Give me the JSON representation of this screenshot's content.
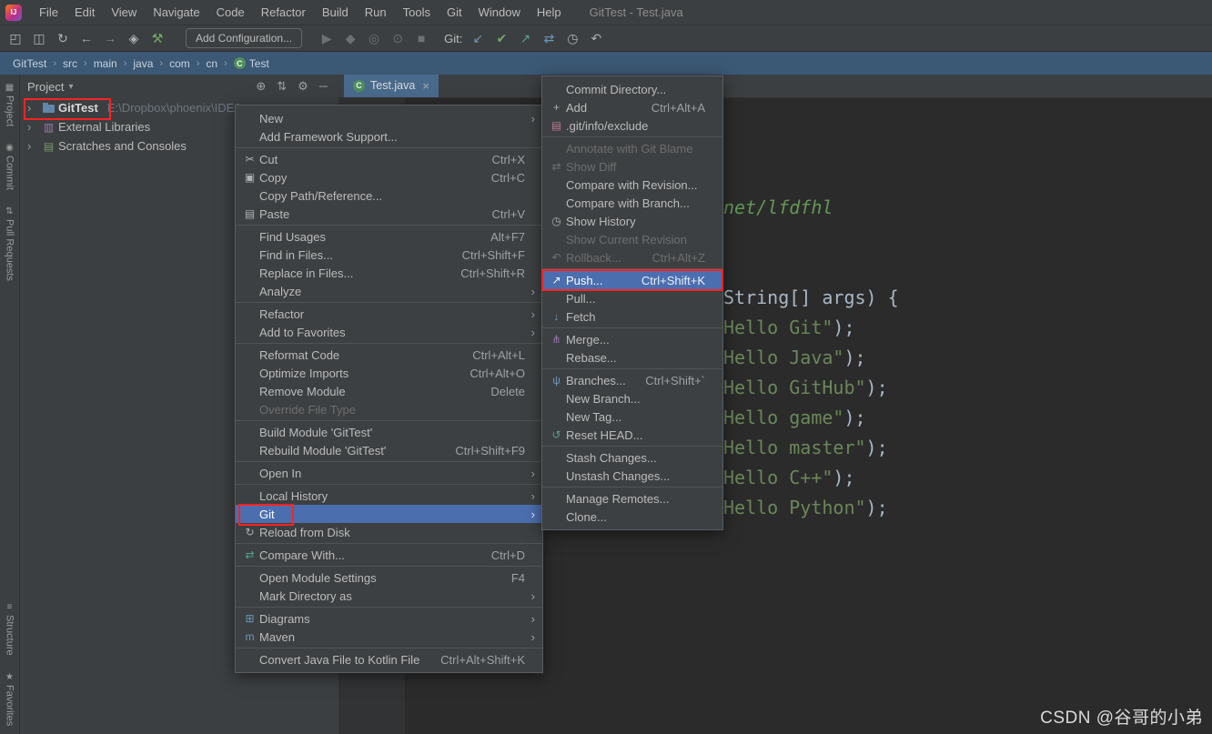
{
  "window": {
    "title": "GitTest - Test.java",
    "logo_text": "IJ",
    "menu_items": [
      "File",
      "Edit",
      "View",
      "Navigate",
      "Code",
      "Refactor",
      "Build",
      "Run",
      "Tools",
      "Git",
      "Window",
      "Help"
    ]
  },
  "toolbar": {
    "left_icons": [
      "open-icon",
      "save-icon",
      "sync-icon",
      "back-icon",
      "forward-icon",
      "modules-icon",
      "build-icon"
    ],
    "add_configuration_label": "Add Configuration...",
    "run_icons": [
      "run-icon",
      "debug-icon",
      "coverage-icon",
      "profiler-icon",
      "stop-icon"
    ],
    "git_label": "Git:",
    "git_icons": [
      "update-project-icon",
      "commit-check-icon",
      "push-arrow-icon",
      "diff-icon",
      "history-icon",
      "rollback-icon"
    ]
  },
  "breadcrumb": {
    "items": [
      {
        "label": "GitTest"
      },
      {
        "label": "src"
      },
      {
        "label": "main"
      },
      {
        "label": "java"
      },
      {
        "label": "com"
      },
      {
        "label": "cn"
      },
      {
        "label": "Test",
        "icon": "class-icon"
      }
    ]
  },
  "left_strip": {
    "top": [
      {
        "label": "Project",
        "icon": "project-tool-icon"
      },
      {
        "label": "Commit",
        "icon": "commit-tool-icon"
      },
      {
        "label": "Pull Requests",
        "icon": "pull-requests-icon"
      }
    ],
    "bottom": [
      {
        "label": "Structure",
        "icon": "structure-tool-icon"
      },
      {
        "label": "Favorites",
        "icon": "favorites-tool-icon"
      }
    ]
  },
  "project_panel": {
    "header": "Project",
    "header_icons": [
      "locate-icon",
      "collapse-all-icon",
      "gear-icon",
      "hide-icon"
    ],
    "tree": [
      {
        "label": "GitTest",
        "path": "E:\\Dropbox\\phoenix\\IDEA",
        "icon": "module-folder-icon",
        "bold": true,
        "red_box": true
      },
      {
        "label": "External Libraries",
        "icon": "libraries-icon"
      },
      {
        "label": "Scratches and Consoles",
        "icon": "scratches-icon"
      }
    ]
  },
  "editor": {
    "tab": {
      "label": "Test.java",
      "icon": "class-icon",
      "close": "×"
    },
    "code_lines": [
      {
        "row": 0,
        "segments": [
          {
            "text": "net/lfdfhl",
            "style": "comment"
          }
        ]
      },
      {
        "row": 3,
        "segments": [
          {
            "text": "String[] args) {",
            "style": "plain"
          }
        ]
      },
      {
        "row": 4,
        "segments": [
          {
            "text": "Hello Git\"",
            "style": "string"
          },
          {
            "text": ");",
            "style": "plain"
          }
        ]
      },
      {
        "row": 5,
        "segments": [
          {
            "text": "Hello Java\"",
            "style": "string"
          },
          {
            "text": ");",
            "style": "plain"
          }
        ]
      },
      {
        "row": 6,
        "segments": [
          {
            "text": "Hello GitHub\"",
            "style": "string"
          },
          {
            "text": ");",
            "style": "plain"
          }
        ]
      },
      {
        "row": 7,
        "segments": [
          {
            "text": "Hello game\"",
            "style": "string"
          },
          {
            "text": ");",
            "style": "plain"
          }
        ]
      },
      {
        "row": 8,
        "segments": [
          {
            "text": "Hello master\"",
            "style": "string"
          },
          {
            "text": ");",
            "style": "plain"
          }
        ]
      },
      {
        "row": 9,
        "segments": [
          {
            "text": "Hello C++\"",
            "style": "string"
          },
          {
            "text": ");",
            "style": "plain"
          }
        ]
      },
      {
        "row": 10,
        "segments": [
          {
            "text": "Hello Python\"",
            "style": "string"
          },
          {
            "text": ");",
            "style": "plain"
          }
        ]
      }
    ]
  },
  "context_menu": {
    "items": [
      {
        "label": "New",
        "submenu": true
      },
      {
        "label": "Add Framework Support..."
      },
      {
        "sep": true
      },
      {
        "label": "Cut",
        "shortcut": "Ctrl+X",
        "icon": "cut-icon"
      },
      {
        "label": "Copy",
        "shortcut": "Ctrl+C",
        "icon": "copy-icon"
      },
      {
        "label": "Copy Path/Reference..."
      },
      {
        "label": "Paste",
        "shortcut": "Ctrl+V",
        "icon": "paste-icon"
      },
      {
        "sep": true
      },
      {
        "label": "Find Usages",
        "shortcut": "Alt+F7"
      },
      {
        "label": "Find in Files...",
        "shortcut": "Ctrl+Shift+F"
      },
      {
        "label": "Replace in Files...",
        "shortcut": "Ctrl+Shift+R"
      },
      {
        "label": "Analyze",
        "submenu": true
      },
      {
        "sep": true
      },
      {
        "label": "Refactor",
        "submenu": true
      },
      {
        "label": "Add to Favorites",
        "submenu": true
      },
      {
        "sep": true
      },
      {
        "label": "Reformat Code",
        "shortcut": "Ctrl+Alt+L"
      },
      {
        "label": "Optimize Imports",
        "shortcut": "Ctrl+Alt+O"
      },
      {
        "label": "Remove Module",
        "shortcut": "Delete"
      },
      {
        "label": "Override File Type",
        "disabled": true
      },
      {
        "sep": true
      },
      {
        "label": "Build Module 'GitTest'"
      },
      {
        "label": "Rebuild Module 'GitTest'",
        "shortcut": "Ctrl+Shift+F9"
      },
      {
        "sep": true
      },
      {
        "label": "Open In",
        "submenu": true
      },
      {
        "sep": true
      },
      {
        "label": "Local History",
        "submenu": true
      },
      {
        "label": "Git",
        "submenu": true,
        "selected": true,
        "red": "label"
      },
      {
        "label": "Reload from Disk",
        "icon": "reload-icon"
      },
      {
        "sep": true
      },
      {
        "label": "Compare With...",
        "shortcut": "Ctrl+D",
        "icon": "compare-icon"
      },
      {
        "sep": true
      },
      {
        "label": "Open Module Settings",
        "shortcut": "F4"
      },
      {
        "label": "Mark Directory as",
        "submenu": true
      },
      {
        "sep": true
      },
      {
        "label": "Diagrams",
        "submenu": true,
        "icon": "diagrams-icon"
      },
      {
        "label": "Maven",
        "submenu": true,
        "icon": "maven-icon"
      },
      {
        "sep": true
      },
      {
        "label": "Convert Java File to Kotlin File",
        "shortcut": "Ctrl+Alt+Shift+K"
      }
    ]
  },
  "git_submenu": {
    "items": [
      {
        "label": "Commit Directory..."
      },
      {
        "label": "Add",
        "shortcut": "Ctrl+Alt+A",
        "icon": "plus-icon"
      },
      {
        "label": ".git/info/exclude",
        "icon": "exclude-icon"
      },
      {
        "sep": true
      },
      {
        "label": "Annotate with Git Blame",
        "disabled": true
      },
      {
        "label": "Show Diff",
        "disabled": true,
        "icon": "show-diff-icon"
      },
      {
        "label": "Compare with Revision..."
      },
      {
        "label": "Compare with Branch..."
      },
      {
        "label": "Show History",
        "icon": "clock-icon"
      },
      {
        "label": "Show Current Revision",
        "disabled": true
      },
      {
        "label": "Rollback...",
        "shortcut": "Ctrl+Alt+Z",
        "disabled": true,
        "icon": "undo-icon"
      },
      {
        "sep": true
      },
      {
        "label": "Push...",
        "shortcut": "Ctrl+Shift+K",
        "selected": true,
        "red": "row",
        "icon": "push-icon"
      },
      {
        "label": "Pull..."
      },
      {
        "label": "Fetch",
        "icon": "fetch-icon"
      },
      {
        "sep": true
      },
      {
        "label": "Merge...",
        "icon": "merge-icon"
      },
      {
        "label": "Rebase..."
      },
      {
        "sep": true
      },
      {
        "label": "Branches...",
        "shortcut": "Ctrl+Shift+`",
        "icon": "branch-icon"
      },
      {
        "label": "New Branch..."
      },
      {
        "label": "New Tag..."
      },
      {
        "label": "Reset HEAD...",
        "icon": "reset-icon"
      },
      {
        "sep": true
      },
      {
        "label": "Stash Changes..."
      },
      {
        "label": "Unstash Changes..."
      },
      {
        "sep": true
      },
      {
        "label": "Manage Remotes..."
      },
      {
        "label": "Clone..."
      }
    ]
  },
  "watermark": "CSDN @谷哥的小弟",
  "colors": {
    "selection_blue": "#4b6eaf",
    "annotation_red": "#ff2222",
    "string_green": "#6a8759",
    "comment_green": "#629755",
    "code_plain": "#a9b7c6",
    "panel_gray": "#3c3f41",
    "editor_bg": "#2b2b2b",
    "breadcrumb_bar_blue": "#3b5874"
  }
}
